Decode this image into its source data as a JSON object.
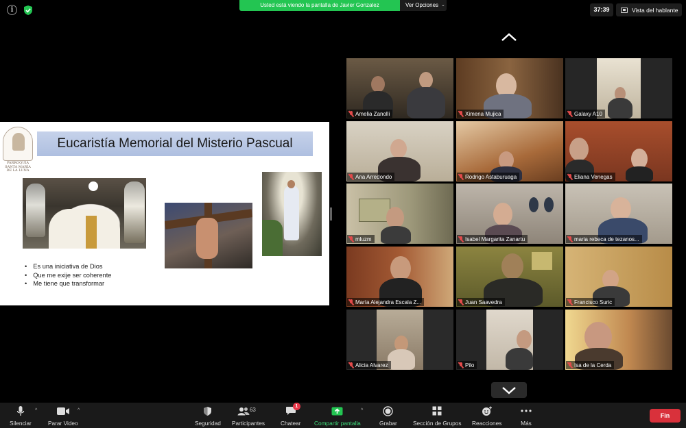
{
  "top_bar": {
    "share_banner": "Usted está viendo la pantalla de Javier Gonzalez",
    "view_options": "Ver Opciones",
    "time": "37:39",
    "speaker_view": "Vista del hablante"
  },
  "slide": {
    "title": "Eucaristía Memorial del Misterio Pascual",
    "logo_text_1": "PARROQUIA",
    "logo_text_2": "SANTA MARÍA",
    "logo_text_3": "DE LA LUNA",
    "bullets": [
      "Es una iniciativa de Dios",
      "Que me exije ser coherente",
      "Me tiene que transformar"
    ]
  },
  "participants": [
    {
      "name": "Amelia Zanolli"
    },
    {
      "name": "Ximena Mujica"
    },
    {
      "name": "Galaxy A10"
    },
    {
      "name": "Ana Arredondo"
    },
    {
      "name": "Rodrigo Astaburuaga"
    },
    {
      "name": "Eliana Venegas"
    },
    {
      "name": "mluzm"
    },
    {
      "name": "Isabel Margarita Zanartu"
    },
    {
      "name": "maria rebeca de tezanos..."
    },
    {
      "name": "María Alejandra Escala Z..."
    },
    {
      "name": "Juan Saavedra"
    },
    {
      "name": "Francisco Suric"
    },
    {
      "name": "Alicia Alvarez"
    },
    {
      "name": "Pilo"
    },
    {
      "name": "Isa de la Cerda"
    }
  ],
  "toolbar": {
    "mute": "Silenciar",
    "stop_video": "Parar Video",
    "security": "Seguridad",
    "participants": "Participantes",
    "participants_count": "63",
    "chat": "Chatear",
    "chat_badge": "1",
    "share_screen": "Compartir pantalla",
    "record": "Grabar",
    "breakout": "Sección de Grupos",
    "reactions": "Reacciones",
    "more": "Más",
    "end": "Fin"
  },
  "icons": {
    "info": "info-icon",
    "security": "shield-check-icon",
    "mic": "microphone-icon",
    "video": "video-camera-icon",
    "participants": "people-icon",
    "chat": "chat-bubble-icon",
    "share": "share-screen-icon",
    "record": "record-icon",
    "breakout": "grid-icon",
    "reactions": "emoji-icon",
    "more": "dots-icon"
  },
  "colors": {
    "share_banner": "#23c552",
    "end_button": "#d9313b",
    "muted_mic": "#e24a4a",
    "share_label": "#3ddc7a"
  }
}
